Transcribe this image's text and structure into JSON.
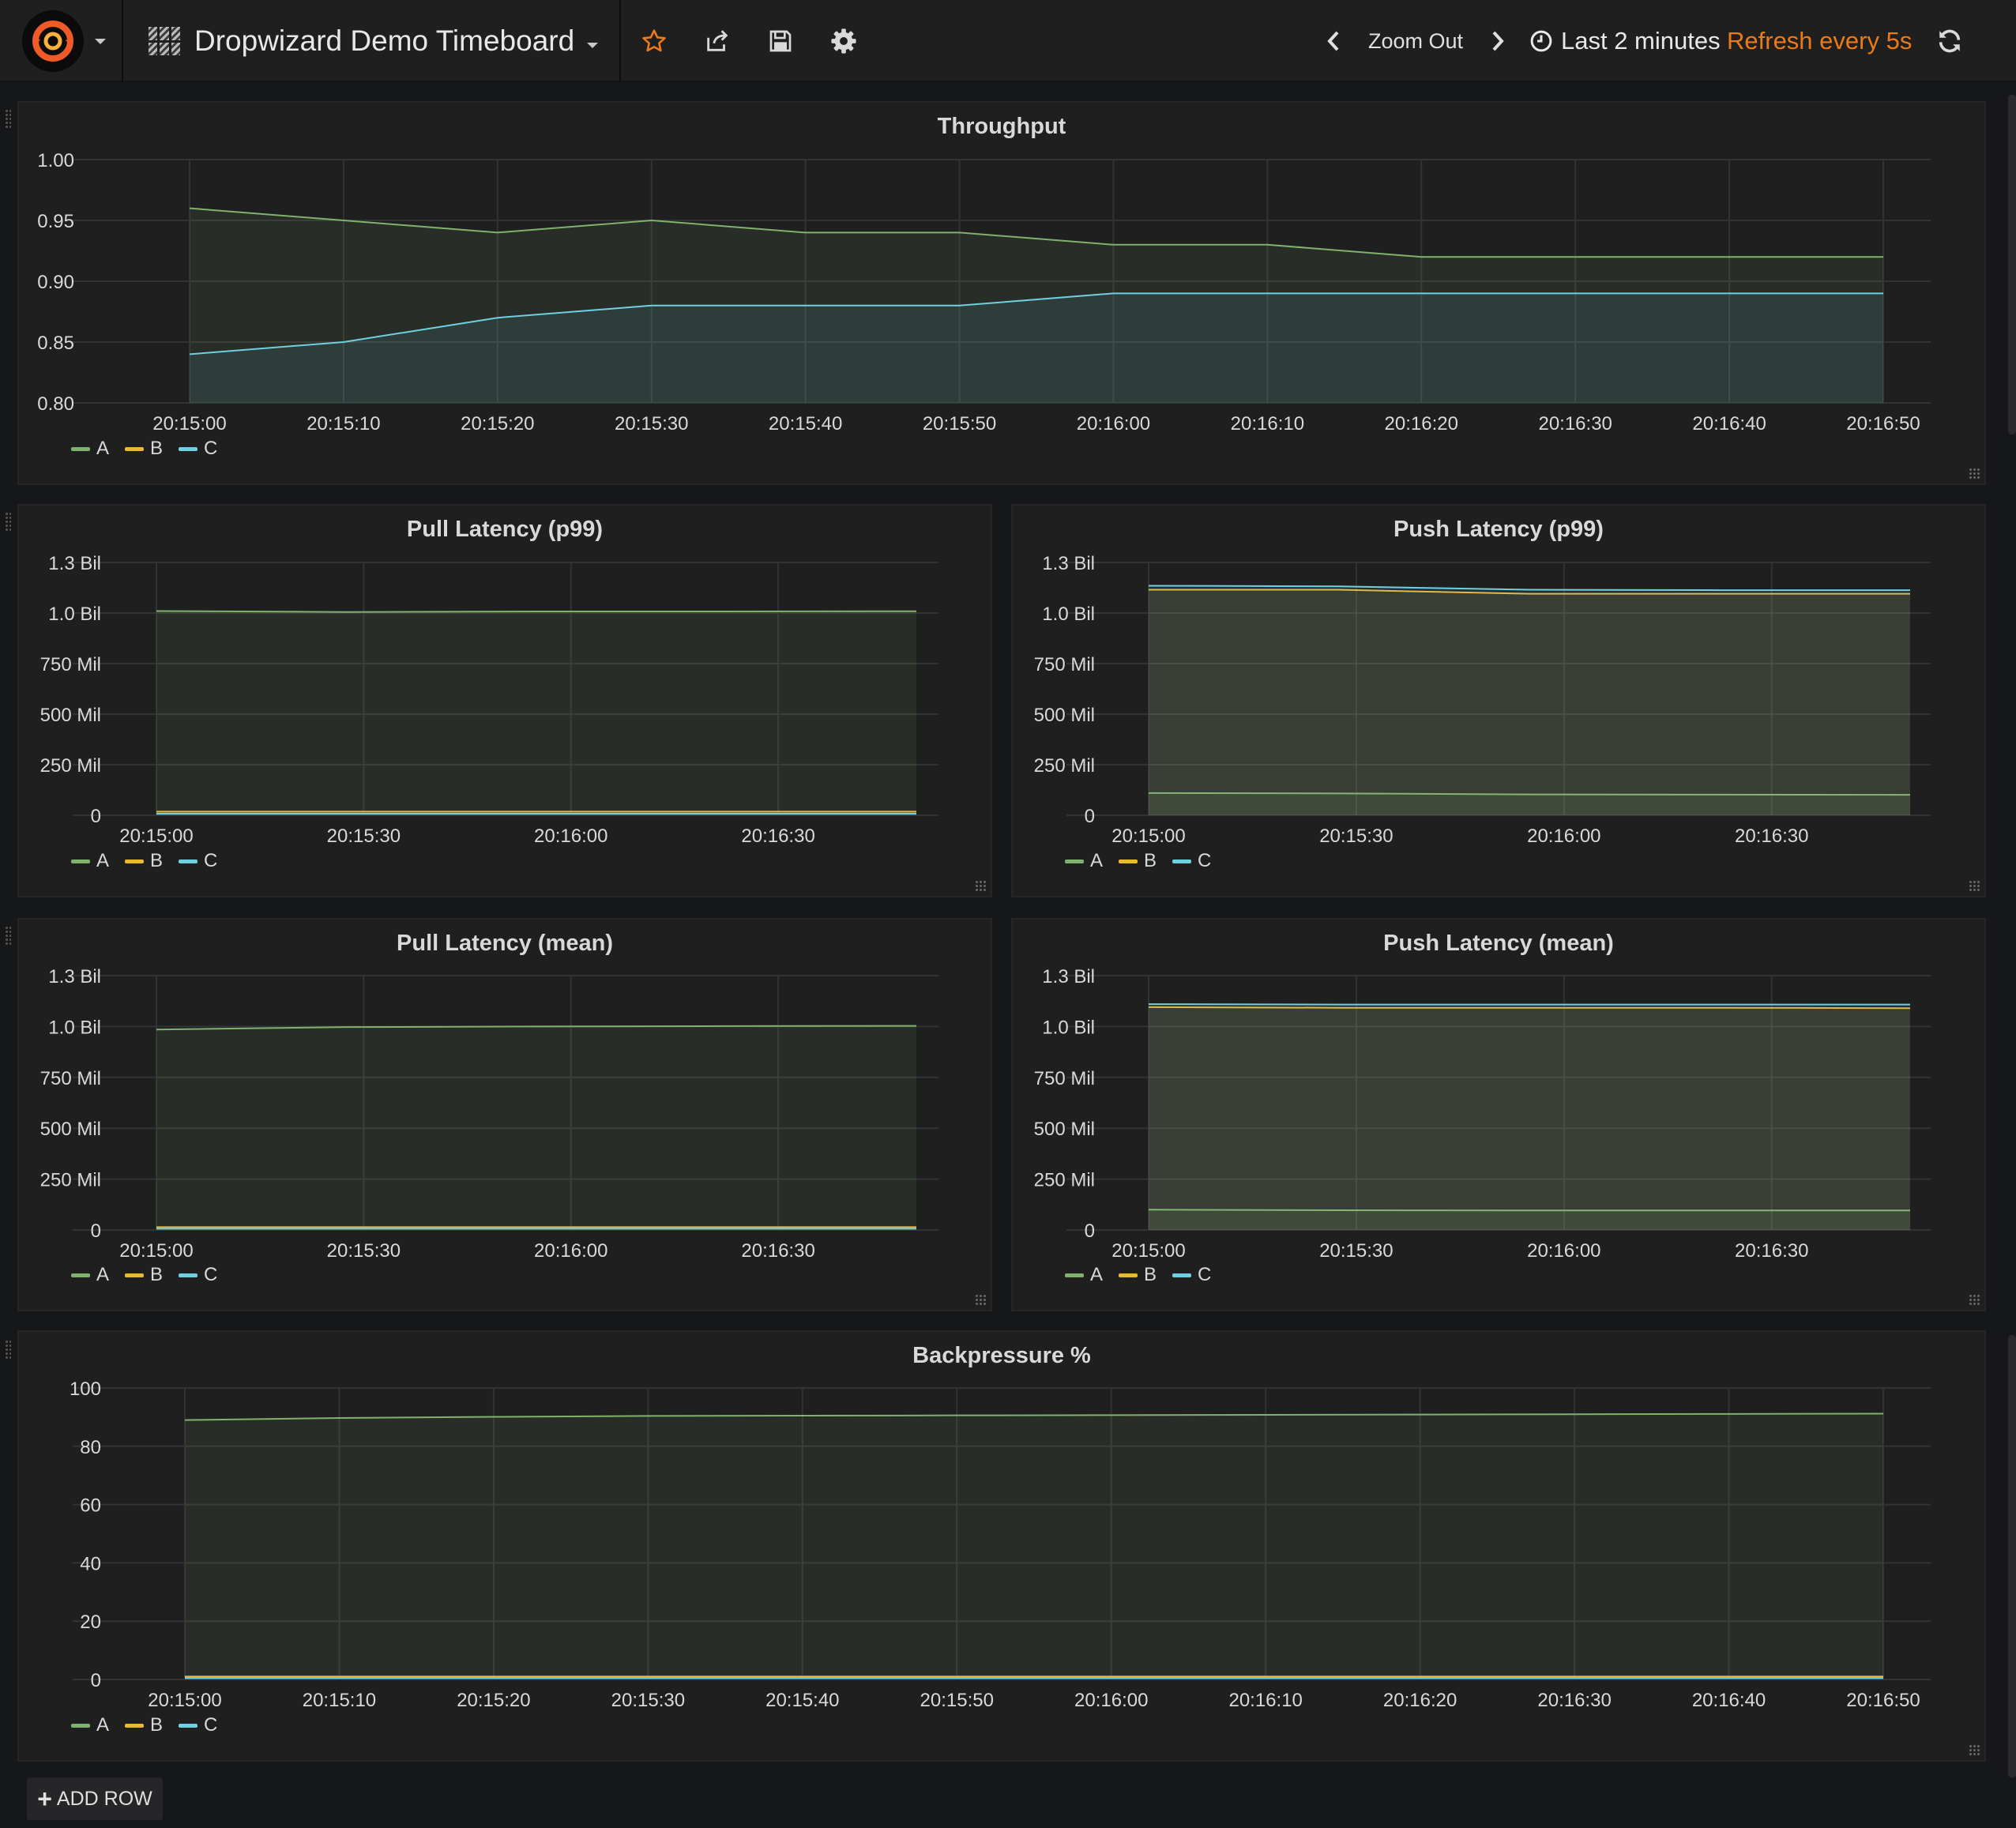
{
  "navbar": {
    "dashboard_title": "Dropwizard Demo Timeboard",
    "zoom_out_label": "Zoom Out",
    "time_range_label": "Last 2 minutes",
    "refresh_label": "Refresh every 5s",
    "refresh_color": "#eb7b18"
  },
  "add_row_label": "ADD ROW",
  "series_colors": {
    "A": "#7eb26d",
    "B": "#eab839",
    "C": "#6ed0e0"
  },
  "panels": [
    {
      "title": "Throughput",
      "legend": [
        "A",
        "B",
        "C"
      ]
    },
    {
      "title": "Pull Latency (p99)",
      "legend": [
        "A",
        "B",
        "C"
      ]
    },
    {
      "title": "Push Latency (p99)",
      "legend": [
        "A",
        "B",
        "C"
      ]
    },
    {
      "title": "Pull Latency (mean)",
      "legend": [
        "A",
        "B",
        "C"
      ]
    },
    {
      "title": "Push Latency (mean)",
      "legend": [
        "A",
        "B",
        "C"
      ]
    },
    {
      "title": "Backpressure %",
      "legend": [
        "A",
        "B",
        "C"
      ]
    }
  ],
  "chart_data": [
    {
      "type": "line",
      "title": "Throughput",
      "xticks": [
        "20:15:00",
        "20:15:10",
        "20:15:20",
        "20:15:30",
        "20:15:40",
        "20:15:50",
        "20:16:00",
        "20:16:10",
        "20:16:20",
        "20:16:30",
        "20:16:40",
        "20:16:50"
      ],
      "yticks": [
        "1.00",
        "0.95",
        "0.90",
        "0.85",
        "0.80"
      ],
      "ylim": [
        0.8,
        1.0
      ],
      "series": [
        {
          "name": "A",
          "values": [
            0.96,
            0.95,
            0.94,
            0.95,
            0.94,
            0.94,
            0.93,
            0.93,
            0.92,
            0.92,
            0.92,
            0.92
          ]
        },
        {
          "name": "C",
          "values": [
            0.84,
            0.85,
            0.87,
            0.88,
            0.88,
            0.88,
            0.89,
            0.89,
            0.89,
            0.89,
            0.89,
            0.89
          ]
        }
      ]
    },
    {
      "type": "line",
      "title": "Pull Latency (p99)",
      "xticks": [
        "20:15:00",
        "20:15:30",
        "20:16:00",
        "20:16:30"
      ],
      "yticks": [
        "1.3 Bil",
        "1.0 Bil",
        "750 Mil",
        "500 Mil",
        "250 Mil",
        "0"
      ],
      "ylim": [
        0,
        1250000000
      ],
      "series": [
        {
          "name": "A",
          "values": [
            1010000000,
            1005000000,
            1008000000,
            1008000000,
            1009000000
          ]
        },
        {
          "name": "B",
          "values": [
            18000000,
            18000000,
            18000000,
            18000000,
            18000000
          ]
        },
        {
          "name": "C",
          "values": [
            8000000,
            8000000,
            8000000,
            8000000,
            8000000
          ]
        }
      ]
    },
    {
      "type": "line",
      "title": "Push Latency (p99)",
      "xticks": [
        "20:15:00",
        "20:15:30",
        "20:16:00",
        "20:16:30"
      ],
      "yticks": [
        "1.3 Bil",
        "1.0 Bil",
        "750 Mil",
        "500 Mil",
        "250 Mil",
        "0"
      ],
      "ylim": [
        0,
        1250000000
      ],
      "series": [
        {
          "name": "A",
          "values": [
            110000000,
            108000000,
            103000000,
            102000000,
            101000000
          ]
        },
        {
          "name": "B",
          "values": [
            1115000000,
            1115000000,
            1095000000,
            1095000000,
            1095000000
          ]
        },
        {
          "name": "C",
          "values": [
            1135000000,
            1132000000,
            1115000000,
            1113000000,
            1113000000
          ]
        }
      ]
    },
    {
      "type": "line",
      "title": "Pull Latency (mean)",
      "xticks": [
        "20:15:00",
        "20:15:30",
        "20:16:00",
        "20:16:30"
      ],
      "yticks": [
        "1.3 Bil",
        "1.0 Bil",
        "750 Mil",
        "500 Mil",
        "250 Mil",
        "0"
      ],
      "ylim": [
        0,
        1250000000
      ],
      "series": [
        {
          "name": "A",
          "values": [
            985000000,
            997000000,
            1000000000,
            1002000000,
            1003000000
          ]
        },
        {
          "name": "B",
          "values": [
            14000000,
            14000000,
            14000000,
            14000000,
            14000000
          ]
        },
        {
          "name": "C",
          "values": [
            7000000,
            7000000,
            7000000,
            7000000,
            7000000
          ]
        }
      ]
    },
    {
      "type": "line",
      "title": "Push Latency (mean)",
      "xticks": [
        "20:15:00",
        "20:15:30",
        "20:16:00",
        "20:16:30"
      ],
      "yticks": [
        "1.3 Bil",
        "1.0 Bil",
        "750 Mil",
        "500 Mil",
        "250 Mil",
        "0"
      ],
      "ylim": [
        0,
        1250000000
      ],
      "series": [
        {
          "name": "A",
          "values": [
            100000000,
            97000000,
            96000000,
            96000000,
            96000000
          ]
        },
        {
          "name": "B",
          "values": [
            1095000000,
            1092000000,
            1092000000,
            1092000000,
            1090000000
          ]
        },
        {
          "name": "C",
          "values": [
            1110000000,
            1108000000,
            1108000000,
            1108000000,
            1108000000
          ]
        }
      ]
    },
    {
      "type": "line",
      "title": "Backpressure %",
      "xticks": [
        "20:15:00",
        "20:15:10",
        "20:15:20",
        "20:15:30",
        "20:15:40",
        "20:15:50",
        "20:16:00",
        "20:16:10",
        "20:16:20",
        "20:16:30",
        "20:16:40",
        "20:16:50"
      ],
      "yticks": [
        "100",
        "80",
        "60",
        "40",
        "20",
        "0"
      ],
      "ylim": [
        0,
        100
      ],
      "series": [
        {
          "name": "A",
          "values": [
            89,
            89.7,
            90.1,
            90.4,
            90.5,
            90.6,
            90.7,
            90.8,
            90.9,
            91,
            91.1,
            91.2
          ]
        },
        {
          "name": "B",
          "values": [
            1,
            1,
            1,
            1,
            1,
            1,
            1,
            1,
            1,
            1,
            1,
            1
          ]
        },
        {
          "name": "C",
          "values": [
            0.5,
            0.5,
            0.5,
            0.5,
            0.5,
            0.5,
            0.5,
            0.5,
            0.5,
            0.5,
            0.5,
            0.5
          ]
        }
      ]
    }
  ]
}
